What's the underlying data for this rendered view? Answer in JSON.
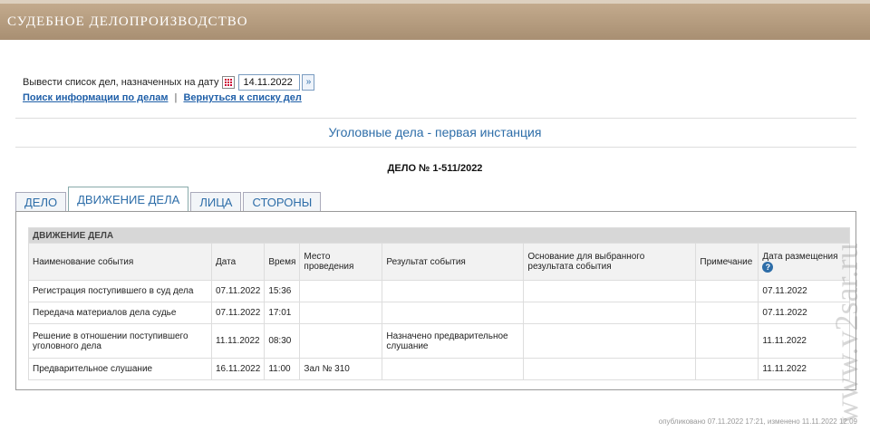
{
  "header": {
    "title": "СУДЕБНОЕ ДЕЛОПРОИЗВОДСТВО"
  },
  "date_filter": {
    "label": "Вывести список дел, назначенных на дату",
    "value": "14.11.2022",
    "go": "»"
  },
  "links": {
    "search": "Поиск информации по делам",
    "separator": "|",
    "back": "Вернуться к списку дел"
  },
  "section_title": "Уголовные дела - первая инстанция",
  "case_number": "ДЕЛО № 1-511/2022",
  "tabs": [
    {
      "label": "ДЕЛО",
      "active": false
    },
    {
      "label": "ДВИЖЕНИЕ ДЕЛА",
      "active": true
    },
    {
      "label": "ЛИЦА",
      "active": false
    },
    {
      "label": "СТОРОНЫ",
      "active": false
    }
  ],
  "table": {
    "caption": "ДВИЖЕНИЕ ДЕЛА",
    "columns": [
      "Наименование события",
      "Дата",
      "Время",
      "Место проведения",
      "Результат события",
      "Основание для выбранного результата события",
      "Примечание",
      "Дата размещения"
    ],
    "help_glyph": "?",
    "rows": [
      [
        "Регистрация поступившего в суд дела",
        "07.11.2022",
        "15:36",
        "",
        "",
        "",
        "",
        "07.11.2022"
      ],
      [
        "Передача материалов дела судье",
        "07.11.2022",
        "17:01",
        "",
        "",
        "",
        "",
        "07.11.2022"
      ],
      [
        "Решение в отношении поступившего уголовного дела",
        "11.11.2022",
        "08:30",
        "",
        "Назначено предварительное слушание",
        "",
        "",
        "11.11.2022"
      ],
      [
        "Предварительное слушание",
        "16.11.2022",
        "11:00",
        "Зал № 310",
        "",
        "",
        "",
        "11.11.2022"
      ]
    ]
  },
  "footer": "опубликовано 07.11.2022 17:21, изменено 11.11.2022 12:09",
  "watermark": "www.v2sar.ru",
  "colors": {
    "topbar": "#b39a7d",
    "link": "#1f5fa8",
    "accent": "#2d6da8"
  }
}
